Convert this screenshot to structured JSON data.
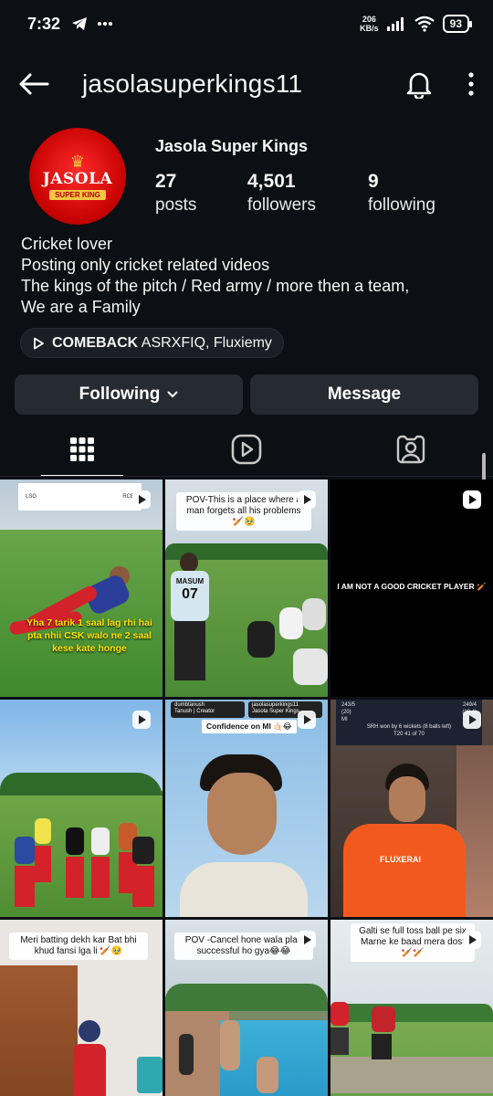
{
  "status_bar": {
    "time": "7:32",
    "net_speed_value": "206",
    "net_speed_unit": "KB/s",
    "battery": "93"
  },
  "header": {
    "username": "jasolasuperkings11"
  },
  "profile": {
    "display_name": "Jasola Super Kings",
    "avatar_logo_main": "JASOLA",
    "avatar_logo_sub": "SUPER KING",
    "stats": [
      {
        "value": "27",
        "label": "posts"
      },
      {
        "value": "4,501",
        "label": "followers"
      },
      {
        "value": "9",
        "label": "following"
      }
    ]
  },
  "bio": {
    "line1": "Cricket lover",
    "line2": "Posting only cricket related videos",
    "line3": "The kings of the pitch / Red army / more then a team,",
    "line4": "We are a Family"
  },
  "music": {
    "title": "COMEBACK",
    "artists": "ASRXFIQ, Fluxiemy"
  },
  "buttons": {
    "following": "Following",
    "message": "Message"
  },
  "posts": [
    {
      "scoreboard_left": "LSG",
      "scoreboard_right": "RCB",
      "caption": "Yha 7 tarik 1 saal lag rhi hai pta nhii CSK walo ne 2 saal kese kate honge"
    },
    {
      "caption": "POV-This is a place where a man forgets all his problems🏏🥹",
      "jersey_name": "MASUM",
      "jersey_number": "07"
    },
    {
      "caption": "I AM NOT A GOOD CRICKET PLAYER 🏏"
    },
    {
      "caption": ""
    },
    {
      "tag_left_name": "dumbtanush",
      "tag_left_sub": "Tanush | Creator",
      "tag_right_name": "jasolasuperkings11",
      "tag_right_sub": "Jasola Super Kings",
      "caption": "Confidence on MI 🤙🏻😂"
    },
    {
      "score_left": "243/5",
      "score_left_overs": "(20)",
      "score_right": "249/4",
      "score_right_overs": "(19.4)",
      "team_label": "MI",
      "result": "SRH won by 6 wickets (8 balls left)",
      "match": "T20 41 of 70",
      "jersey_brand": "FLUXERAI"
    },
    {
      "caption": "Meri batting dekh kar Bat bhi khud fansi lga li 🏏🥹"
    },
    {
      "caption": "POV -Cancel hone wala plan successful ho gya😂😂"
    },
    {
      "caption": "Galti se full toss ball pe six Marne ke baad mera dost🏏🏏"
    }
  ],
  "colors": {
    "background": "#0c0f14",
    "button": "#262a31",
    "avatar_red": "#c40000",
    "overlay_yellow": "#ffe600"
  }
}
